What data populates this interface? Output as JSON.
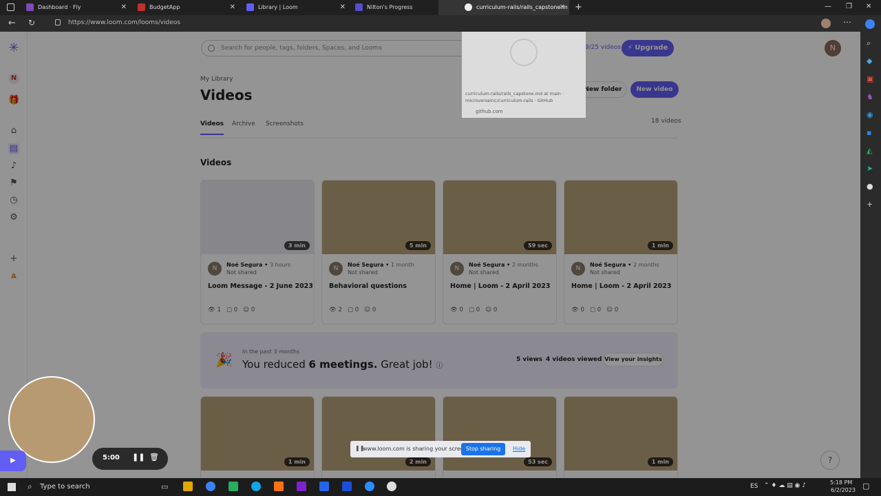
{
  "browser": {
    "tabs": [
      {
        "title": "Dashboard · Fly",
        "icon": "fly-icon"
      },
      {
        "title": "BudgetApp",
        "icon": "budget-icon"
      },
      {
        "title": "Library | Loom",
        "icon": "loom-icon"
      },
      {
        "title": "Nilton's Progress",
        "icon": "progress-icon"
      },
      {
        "title": "curriculum-rails/rails_capstone.m",
        "icon": "github-icon"
      }
    ],
    "url": "https://www.loom.com/looms/videos",
    "hover": {
      "line1": "curriculum-rails/rails_capstone.md at main ·",
      "line2": "microverseinc/curriculum-rails · GitHub",
      "domain": "github.com"
    }
  },
  "header": {
    "search_placeholder": "Search for people, tags, folders, Spaces, and Looms",
    "quota": "19/25 videos",
    "upgrade": "Upgrade",
    "avatar": "N"
  },
  "library": {
    "section": "My Library",
    "title": "Videos",
    "tabs": [
      "Videos",
      "Archive",
      "Screenshots"
    ],
    "count": "18 videos",
    "new_folder": "New folder",
    "new_video": "New video",
    "subheading": "Videos"
  },
  "cards": [
    {
      "owner": "Noé Segura",
      "age": "3 hours",
      "shared": "Not shared",
      "title": "Loom Message - 2 June 2023",
      "duration": "3 min",
      "views": "1",
      "comments": "0",
      "reactions": "0"
    },
    {
      "owner": "Noé Segura",
      "age": "1 month",
      "shared": "Not shared",
      "title": "Behavioral questions",
      "duration": "5 min",
      "views": "2",
      "comments": "0",
      "reactions": "0"
    },
    {
      "owner": "Noé Segura",
      "age": "2 months",
      "shared": "Not shared",
      "title": "Home | Loom - 2 April 2023",
      "duration": "59 sec",
      "views": "0",
      "comments": "0",
      "reactions": "0"
    },
    {
      "owner": "Noé Segura",
      "age": "2 months",
      "shared": "Not shared",
      "title": "Home | Loom - 2 April 2023",
      "duration": "1 min",
      "views": "0",
      "comments": "0",
      "reactions": "0"
    }
  ],
  "row2_durations": [
    "1 min",
    "2 min",
    "53 sec",
    "1 min"
  ],
  "insights": {
    "period": "In the past 3 months",
    "message_pre": "You reduced ",
    "message_bold": "6 meetings.",
    "message_post": " Great job!",
    "views": "5 views",
    "viewed": "4 videos viewed",
    "button": "View your insights"
  },
  "recorder": {
    "timer": "5:00"
  },
  "share_bar": {
    "text": "www.loom.com is sharing your screen.",
    "stop": "Stop sharing",
    "hide": "Hide"
  },
  "taskbar": {
    "search": "Type to search",
    "lang": "ES",
    "time": "5:18 PM",
    "date": "6/2/2023"
  }
}
